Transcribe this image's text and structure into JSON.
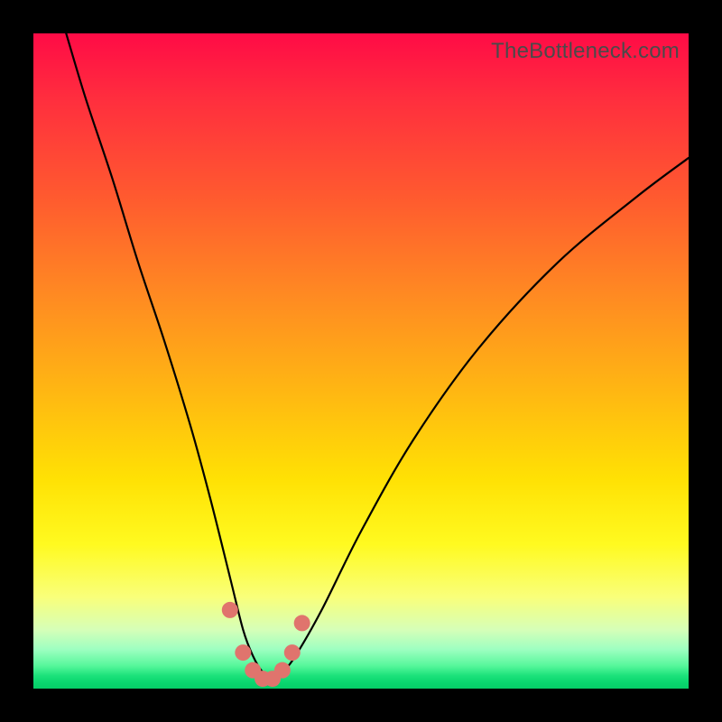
{
  "watermark": "TheBottleneck.com",
  "chart_data": {
    "type": "line",
    "title": "",
    "xlabel": "",
    "ylabel": "",
    "xlim": [
      0,
      100
    ],
    "ylim": [
      0,
      100
    ],
    "series": [
      {
        "name": "bottleneck-curve",
        "x": [
          5,
          8,
          12,
          16,
          20,
          24,
          27,
          30,
          32,
          33.5,
          35,
          36.5,
          38,
          40,
          44,
          50,
          58,
          68,
          80,
          92,
          100
        ],
        "values": [
          100,
          90,
          78,
          65,
          53,
          40,
          29,
          17,
          9,
          5,
          2.5,
          1.5,
          2.5,
          5,
          12,
          24,
          38,
          52,
          65,
          75,
          81
        ]
      }
    ],
    "markers": {
      "name": "highlight-points",
      "color": "#e0746d",
      "x": [
        30,
        32,
        33.5,
        35,
        36.5,
        38,
        39.5,
        41
      ],
      "values": [
        12,
        5.5,
        2.8,
        1.5,
        1.5,
        2.8,
        5.5,
        10
      ]
    },
    "background_gradient": {
      "top": "#ff0b46",
      "mid": "#ffe104",
      "bottom": "#06cd67"
    }
  }
}
